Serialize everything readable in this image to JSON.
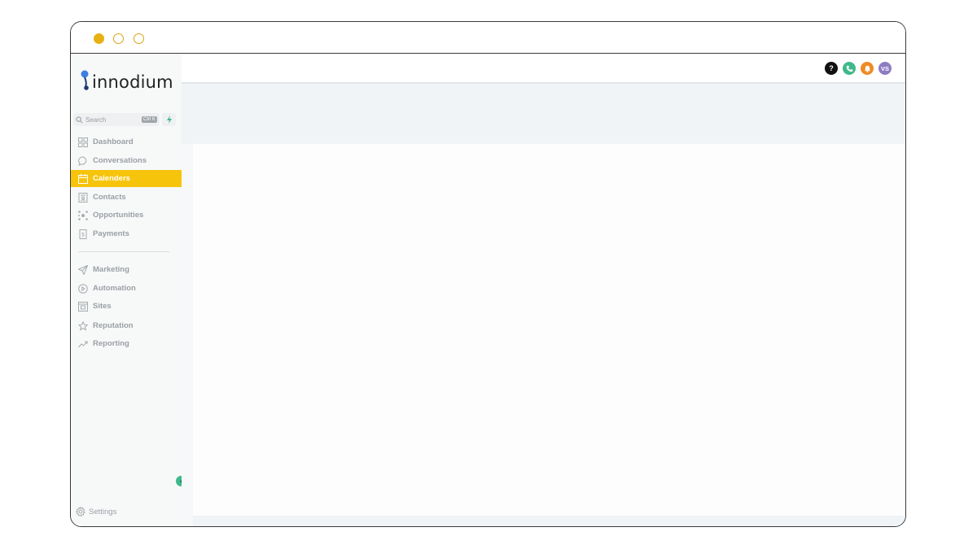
{
  "window": {
    "controls": [
      "close",
      "minimize",
      "maximize"
    ]
  },
  "brand": {
    "name": "innodium",
    "logo_color": "#3d7fe0"
  },
  "search": {
    "placeholder": "Search",
    "shortcut": "Ctrl K"
  },
  "sidebar": {
    "primary": [
      {
        "label": "Dashboard",
        "icon": "grid-icon",
        "active": false
      },
      {
        "label": "Conversations",
        "icon": "chat-bubble-icon",
        "active": false
      },
      {
        "label": "Calenders",
        "icon": "calendar-icon",
        "active": true
      },
      {
        "label": "Contacts",
        "icon": "contacts-icon",
        "active": false
      },
      {
        "label": "Opportunities",
        "icon": "network-icon",
        "active": false
      },
      {
        "label": "Payments",
        "icon": "receipt-icon",
        "active": false
      }
    ],
    "secondary": [
      {
        "label": "Marketing",
        "icon": "send-icon"
      },
      {
        "label": "Automation",
        "icon": "play-circle-icon"
      },
      {
        "label": "Sites",
        "icon": "site-icon"
      },
      {
        "label": "Reputation",
        "icon": "star-icon"
      },
      {
        "label": "Reporting",
        "icon": "trend-icon"
      }
    ],
    "settings_label": "Settings"
  },
  "topbar": {
    "help_label": "?",
    "avatar_initials": "VS",
    "colors": {
      "help": "#111111",
      "phone": "#3fb88a",
      "bell": "#f08a24",
      "avatar": "#8e7cc3"
    }
  },
  "colors": {
    "accent": "#f7c40c",
    "window_dot": "#e8b012"
  }
}
